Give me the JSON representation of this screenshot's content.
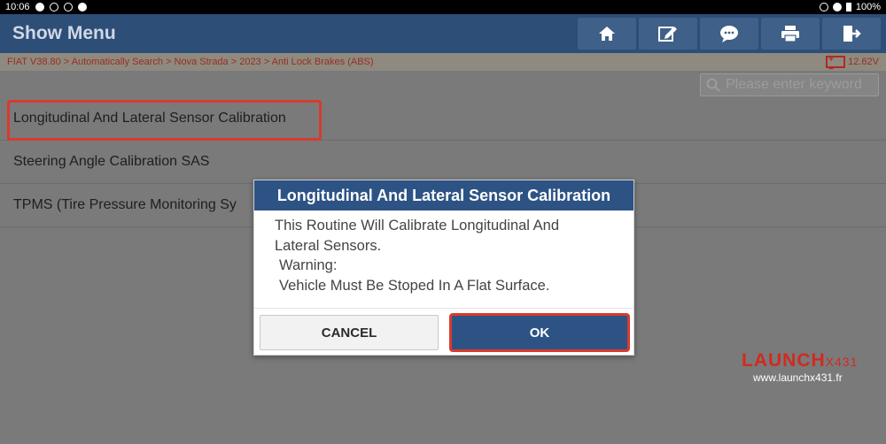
{
  "status_bar": {
    "time": "10:06",
    "battery": "100%"
  },
  "header": {
    "title": "Show Menu"
  },
  "toolbar": {
    "icons": [
      "home-icon",
      "edit-icon",
      "chat-icon",
      "print-icon",
      "exit-icon"
    ]
  },
  "breadcrumb": {
    "path": "FIAT V38.80 > Automatically Search > Nova Strada > 2023 > Anti Lock Brakes (ABS)",
    "voltage": "12.62V"
  },
  "search": {
    "placeholder": "Please enter keyword"
  },
  "menu": {
    "items": [
      {
        "label": "Longitudinal And Lateral Sensor Calibration"
      },
      {
        "label": "Steering Angle Calibration SAS"
      },
      {
        "label": "TPMS (Tire Pressure Monitoring Sy"
      }
    ]
  },
  "dialog": {
    "title": "Longitudinal And Lateral Sensor Calibration",
    "lines": [
      "This Routine Will Calibrate Longitudinal And",
      "Lateral Sensors.",
      "Warning:",
      "Vehicle Must Be Stoped In A Flat Surface."
    ],
    "cancel_label": "CANCEL",
    "ok_label": "OK"
  },
  "watermark": {
    "logo": "LAUNCH",
    "logo_suffix": "X431",
    "url": "www.launchx431.fr"
  },
  "colors": {
    "header": "#2d4e76",
    "dialog_title": "#2d5385",
    "highlight": "#d83a2e"
  }
}
